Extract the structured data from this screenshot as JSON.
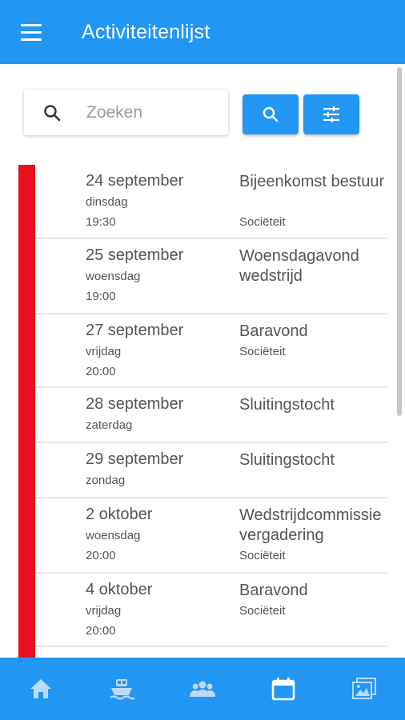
{
  "appbar": {
    "title": "Activiteitenlijst",
    "menu_icon": "menu-icon"
  },
  "search": {
    "placeholder": "Zoeken",
    "value": ""
  },
  "colors": {
    "primary": "#2196F3",
    "category_bar": "#e8101c"
  },
  "activities": [
    {
      "date": "24 september",
      "day": "dinsdag",
      "time": "19:30",
      "title": "Bijeenkomst bestuur",
      "location": "Sociëteit"
    },
    {
      "date": "25 september",
      "day": "woensdag",
      "time": "19:00",
      "title": "Woensdagavond wedstrijd",
      "location": ""
    },
    {
      "date": "27 september",
      "day": "vrijdag",
      "time": "20:00",
      "title": "Baravond",
      "location": "Sociëteit"
    },
    {
      "date": "28 september",
      "day": "zaterdag",
      "time": "",
      "title": "Sluitingstocht",
      "location": ""
    },
    {
      "date": "29 september",
      "day": "zondag",
      "time": "",
      "title": "Sluitingstocht",
      "location": ""
    },
    {
      "date": "2 oktober",
      "day": "woensdag",
      "time": "20:00",
      "title": "Wedstrijdcommissievergadering",
      "location": "Sociëteit"
    },
    {
      "date": "4 oktober",
      "day": "vrijdag",
      "time": "20:00",
      "title": "Baravond",
      "location": "Sociëteit"
    }
  ],
  "bottom_nav": [
    "home-icon",
    "boat-icon",
    "group-icon",
    "calendar-icon",
    "photos-icon"
  ]
}
